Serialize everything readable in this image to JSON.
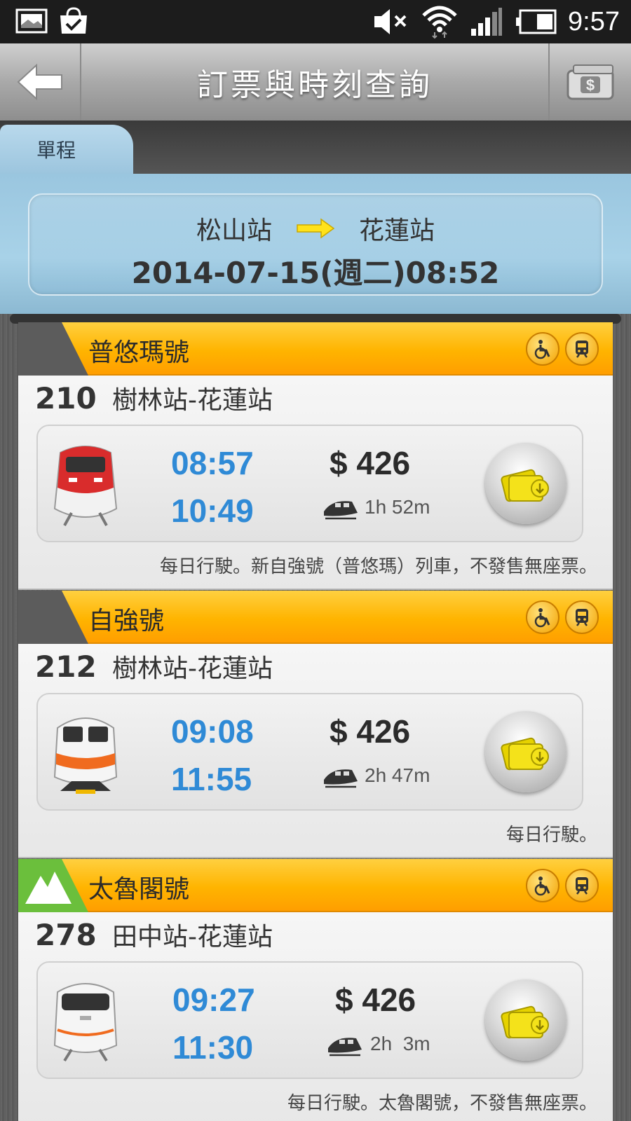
{
  "status_bar": {
    "time": "9:57"
  },
  "header": {
    "title": "訂票與時刻查詢"
  },
  "tabs": [
    {
      "label": "單程"
    }
  ],
  "query": {
    "from": "松山站",
    "to": "花蓮站",
    "datetime": "2014-07-15(週二)08:52"
  },
  "trains": [
    {
      "type": "普悠瑪號",
      "number": "210",
      "route": "樹林站-花蓮站",
      "depart": "08:57",
      "arrive": "10:49",
      "price": "$ 426",
      "duration": "1h 52m",
      "note": "每日行駛。新自強號（普悠瑪）列車，不發售無座票。",
      "flag": "gray",
      "train_icon": "puyuma-train-icon"
    },
    {
      "type": "自強號",
      "number": "212",
      "route": "樹林站-花蓮站",
      "depart": "09:08",
      "arrive": "11:55",
      "price": "$ 426",
      "duration": "2h 47m",
      "note": "每日行駛。",
      "flag": "gray",
      "train_icon": "tzechiang-train-icon"
    },
    {
      "type": "太魯閣號",
      "number": "278",
      "route": "田中站-花蓮站",
      "depart": "09:27",
      "arrive": "11:30",
      "price": "$ 426",
      "duration": "2h  3m",
      "note": "每日行駛。太魯閣號，不發售無座票。",
      "flag": "green",
      "train_icon": "taroko-train-icon"
    }
  ],
  "colors": {
    "accent_orange": "#ffb400",
    "time_blue": "#2f8ad6",
    "summary_blue": "#a8d2e8"
  }
}
